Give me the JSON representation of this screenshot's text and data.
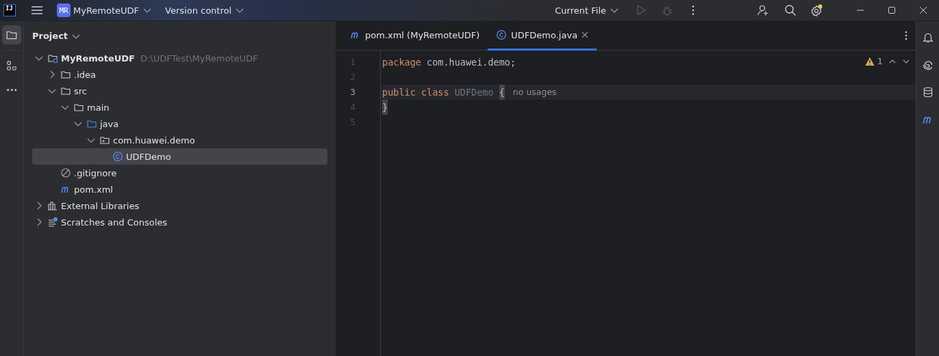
{
  "title_bar": {
    "logo": "IJ",
    "project_badge": "MR",
    "project": "MyRemoteUDF",
    "vcs": "Version control",
    "run_config": "Current File",
    "settings_update": true
  },
  "left_stripe": [
    {
      "kind": "folder",
      "selected": true
    },
    {
      "kind": "structure",
      "selected": false
    },
    {
      "kind": "more",
      "selected": false
    }
  ],
  "project_panel": {
    "title": "Project",
    "tree": [
      {
        "label": "MyRemoteUDF",
        "path": "D:\\UDFTest\\MyRemoteUDF",
        "kind": "module",
        "bold": true,
        "expanded": true,
        "selected": false,
        "children": [
          {
            "label": ".idea",
            "kind": "folder",
            "expanded": false,
            "selected": false
          },
          {
            "label": "src",
            "kind": "folder",
            "expanded": true,
            "selected": false,
            "children": [
              {
                "label": "main",
                "kind": "folder",
                "expanded": true,
                "selected": false,
                "children": [
                  {
                    "label": "java",
                    "kind": "source-folder",
                    "expanded": true,
                    "selected": false,
                    "children": [
                      {
                        "label": "com.huawei.demo",
                        "kind": "package",
                        "expanded": true,
                        "selected": false,
                        "children": [
                          {
                            "label": "UDFDemo",
                            "kind": "class",
                            "selected": true
                          }
                        ]
                      }
                    ]
                  }
                ]
              }
            ]
          },
          {
            "label": ".gitignore",
            "kind": "ignore",
            "selected": false
          },
          {
            "label": "pom.xml",
            "kind": "maven",
            "selected": false
          }
        ]
      },
      {
        "label": "External Libraries",
        "kind": "libraries",
        "expanded": false,
        "selected": false
      },
      {
        "label": "Scratches and Consoles",
        "kind": "scratches",
        "expanded": false,
        "selected": false
      }
    ]
  },
  "editor": {
    "tabs": [
      {
        "label": "pom.xml (MyRemoteUDF)",
        "kind": "maven",
        "selected": false,
        "closable": false
      },
      {
        "label": "UDFDemo.java",
        "kind": "class",
        "selected": true,
        "closable": true
      }
    ],
    "warnings": "1",
    "lines": [
      {
        "number": "1",
        "current": false,
        "tokens": [
          {
            "kind": "keyword",
            "text": "package"
          },
          {
            "kind": "text",
            "text": " com.huawei.demo;"
          }
        ]
      },
      {
        "number": "2",
        "current": false
      },
      {
        "number": "3",
        "current": true,
        "tokens": [
          {
            "kind": "keyword",
            "text": "public class "
          },
          {
            "kind": "unused",
            "text": "UDFDemo "
          },
          {
            "kind": "brace",
            "text": "{"
          }
        ],
        "hint": "no usages"
      },
      {
        "number": "4",
        "current": false,
        "tokens": [
          {
            "kind": "brace",
            "text": "}"
          }
        ]
      },
      {
        "number": "5",
        "current": false
      }
    ]
  },
  "right_stripe": [
    {
      "kind": "bell"
    },
    {
      "kind": "spiral"
    },
    {
      "kind": "database"
    },
    {
      "kind": "maven"
    }
  ]
}
